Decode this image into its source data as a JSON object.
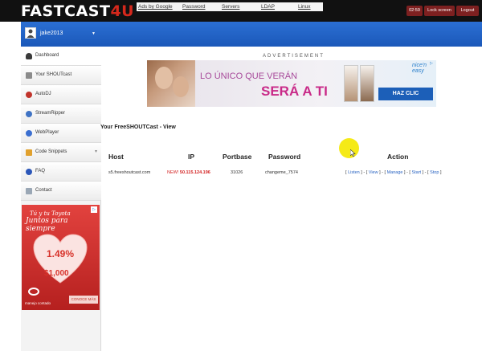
{
  "topbar": {
    "logo_text": "FASTCAST",
    "logo_num": "4U",
    "nav": [
      "Ads by Google",
      "Password",
      "Servers",
      "LDAP",
      "Linux"
    ],
    "time": "02:59",
    "lock_label": "Lock screen",
    "logout_label": "Logout"
  },
  "user": {
    "name": "jake2013",
    "caret": "▼"
  },
  "sidebar": {
    "items": [
      {
        "label": "Dashboard",
        "icon": "dashboard-icon"
      },
      {
        "label": "Your SHOUTcast",
        "icon": "shoutcast-icon"
      },
      {
        "label": "AutoDJ",
        "icon": "autodj-icon"
      },
      {
        "label": "StreamRipper",
        "icon": "streamripper-icon"
      },
      {
        "label": "WebPlayer",
        "icon": "webplayer-icon"
      },
      {
        "label": "Code Snippets",
        "icon": "code-icon",
        "arrow": "▾"
      },
      {
        "label": "FAQ",
        "icon": "info-icon"
      },
      {
        "label": "Contact",
        "icon": "mail-icon"
      }
    ]
  },
  "side_ad": {
    "line1": "Tú y tu Toyota",
    "line2": "Juntos para siempre",
    "rate": "1.49%",
    "amount": "$1,000",
    "footer": "manejo contado",
    "cta": "CONOCE MÁS"
  },
  "banner": {
    "label": "ADVERTISEMENT",
    "line1": "LO ÚNICO QUE VERÁN",
    "line2": "SERÁ A TI",
    "brand": "nice'n easy",
    "cta": "HAZ CLIC"
  },
  "main": {
    "title": "Your FreeSHOUTCast - View",
    "headers": {
      "host": "Host",
      "ip": "IP",
      "port": "Portbase",
      "password": "Password",
      "action": "Action"
    },
    "row": {
      "host": "s5.freeshoutcast.com",
      "ip_new": "NEW!",
      "ip": "50.115.124.196",
      "port": "31026",
      "password": "changeme_7574",
      "actions": [
        "Listen",
        "View",
        "Manage",
        "Start",
        "Stop"
      ]
    }
  }
}
